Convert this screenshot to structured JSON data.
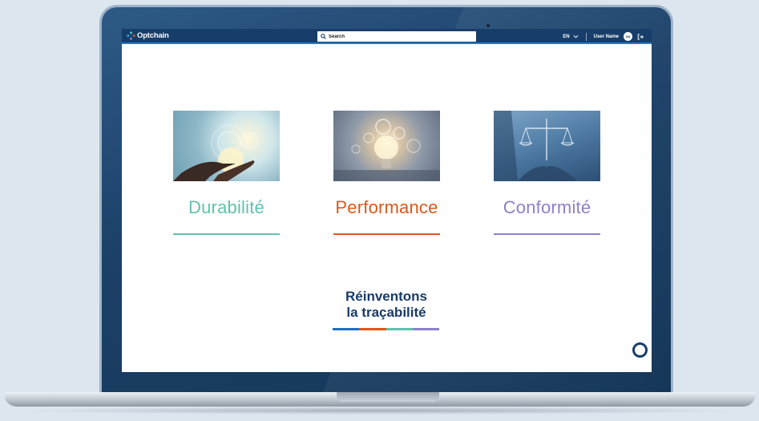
{
  "header": {
    "logo_text": "Optchain",
    "search_placeholder": "Search",
    "language": "EN",
    "user_name": "User Name",
    "avatar_initials": "UN"
  },
  "cards": [
    {
      "title": "Durabilité",
      "color": "#5fc1ad"
    },
    {
      "title": "Performance",
      "color": "#d9591b"
    },
    {
      "title": "Conformité",
      "color": "#8f7fc8"
    }
  ],
  "tagline": {
    "line1": "Réinventons",
    "line2": "la traçabilité",
    "bar_colors": [
      "#1f70c1",
      "#d9591b",
      "#5fc1ad",
      "#8f7fc8"
    ]
  },
  "icons": {
    "search": "search-icon",
    "language_dropdown": "chevron-down-icon",
    "logout": "logout-icon",
    "chat": "chat-icon"
  }
}
